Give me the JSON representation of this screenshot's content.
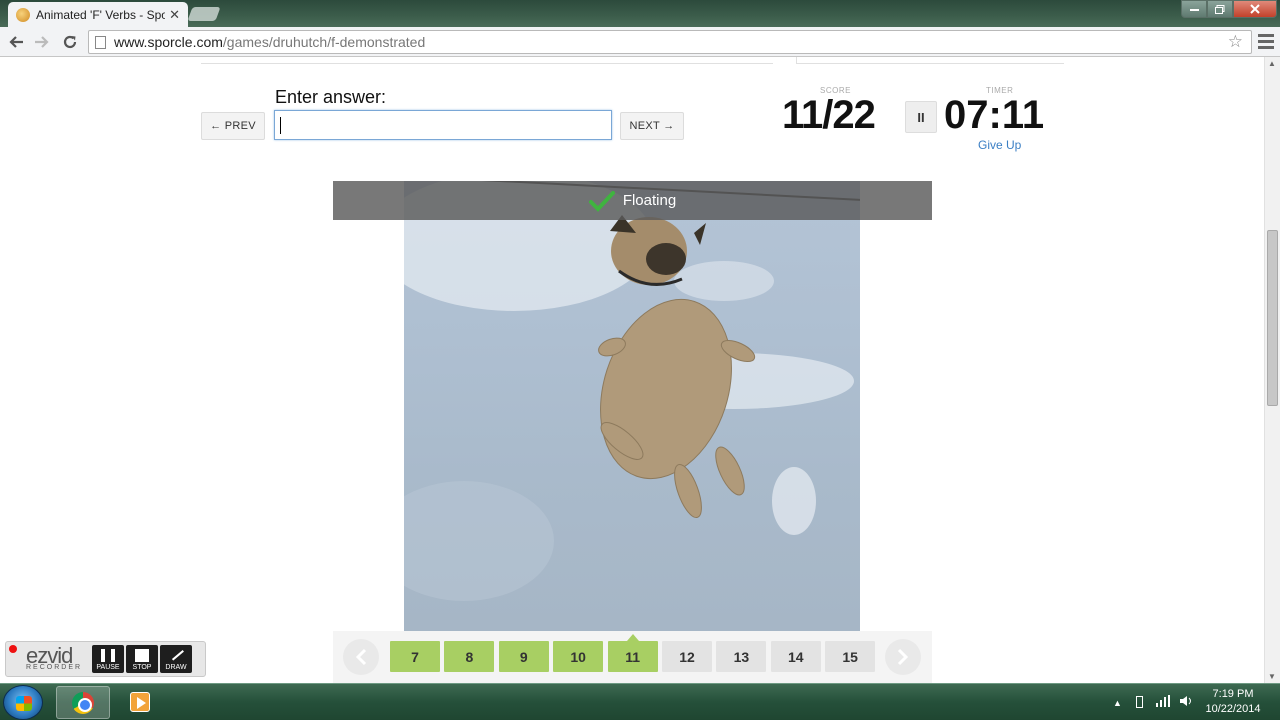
{
  "browser": {
    "tab_title": "Animated 'F' Verbs - Sporcle",
    "tab_close": "✕",
    "url_host": "www.sporcle.com",
    "url_path": "/games/druhutch/f-demonstrated"
  },
  "quiz": {
    "enter_label": "Enter answer:",
    "prev_label": "← PREV",
    "next_label": "NEXT →",
    "answer_value": "",
    "score_label": "SCORE",
    "score_value": "11/22",
    "timer_label": "TIMER",
    "timer_value": "07:11",
    "pause_label": "II",
    "give_up_label": "Give Up",
    "current_answer": "Floating",
    "progress": {
      "answered": 11,
      "total": 22
    }
  },
  "answer_nav": {
    "items": [
      {
        "label": "7",
        "status": "done"
      },
      {
        "label": "8",
        "status": "done"
      },
      {
        "label": "9",
        "status": "done"
      },
      {
        "label": "10",
        "status": "done"
      },
      {
        "label": "11",
        "status": "done",
        "current": true
      },
      {
        "label": "12",
        "status": "todo"
      },
      {
        "label": "13",
        "status": "todo"
      },
      {
        "label": "14",
        "status": "todo"
      },
      {
        "label": "15",
        "status": "todo"
      }
    ],
    "colors": {
      "done": "#a8cf63",
      "todo": "#e3e3e3"
    }
  },
  "ezvid": {
    "logo": "ezvid",
    "subtitle": "RECORDER",
    "pause_label": "PAUSE",
    "stop_label": "STOP",
    "draw_label": "DRAW"
  },
  "taskbar": {
    "time": "7:19 PM",
    "date": "10/22/2014"
  },
  "icons": {
    "check": "check-icon",
    "star": "star-icon",
    "pause": "pause-icon"
  }
}
